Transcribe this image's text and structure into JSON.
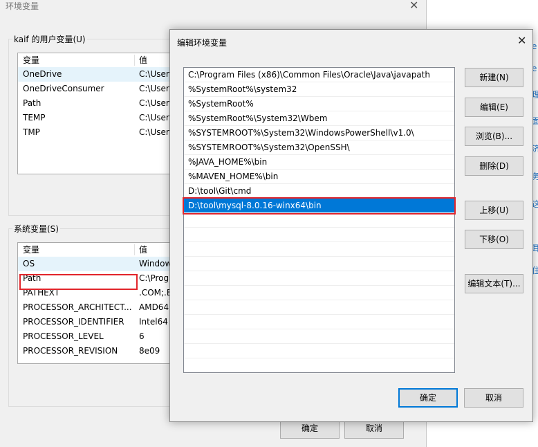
{
  "bg_window": {
    "title": "环境变量",
    "close_glyph": "✕",
    "user_group_label": "kaif 的用户变量(U)",
    "system_group_label": "系统变量(S)",
    "columns": [
      "变量",
      "值"
    ],
    "user_vars": [
      {
        "name": "OneDrive",
        "value": "C:\\User"
      },
      {
        "name": "OneDriveConsumer",
        "value": "C:\\User"
      },
      {
        "name": "Path",
        "value": "C:\\User"
      },
      {
        "name": "TEMP",
        "value": "C:\\User"
      },
      {
        "name": "TMP",
        "value": "C:\\User"
      }
    ],
    "system_vars": [
      {
        "name": "OS",
        "value": "Window"
      },
      {
        "name": "Path",
        "value": "C:\\Prog"
      },
      {
        "name": "PATHEXT",
        "value": ".COM;.E"
      },
      {
        "name": "PROCESSOR_ARCHITECT...",
        "value": "AMD64"
      },
      {
        "name": "PROCESSOR_IDENTIFIER",
        "value": "Intel64"
      },
      {
        "name": "PROCESSOR_LEVEL",
        "value": "6"
      },
      {
        "name": "PROCESSOR_REVISION",
        "value": "8e09"
      }
    ],
    "ok_label": "确定",
    "cancel_label": "取消"
  },
  "right_strip_chars": [
    "e",
    "e",
    "理",
    "面",
    "济",
    "务",
    "这",
    "耳",
    "住"
  ],
  "dialog": {
    "title": "编辑环境变量",
    "close_glyph": "✕",
    "paths": [
      "C:\\Program Files (x86)\\Common Files\\Oracle\\Java\\javapath",
      "%SystemRoot%\\system32",
      "%SystemRoot%",
      "%SystemRoot%\\System32\\Wbem",
      "%SYSTEMROOT%\\System32\\WindowsPowerShell\\v1.0\\",
      "%SYSTEMROOT%\\System32\\OpenSSH\\",
      "%JAVA_HOME%\\bin",
      "%MAVEN_HOME%\\bin",
      "D:\\tool\\Git\\cmd",
      "D:\\tool\\mysql-8.0.16-winx64\\bin"
    ],
    "selected_index": 9,
    "buttons": {
      "new": "新建(N)",
      "edit": "编辑(E)",
      "browse": "浏览(B)...",
      "delete": "删除(D)",
      "move_up": "上移(U)",
      "move_down": "下移(O)",
      "edit_text": "编辑文本(T)...",
      "ok": "确定",
      "cancel": "取消"
    }
  },
  "colors": {
    "highlight": "#0078d7",
    "annotation_red": "#e2252b"
  }
}
